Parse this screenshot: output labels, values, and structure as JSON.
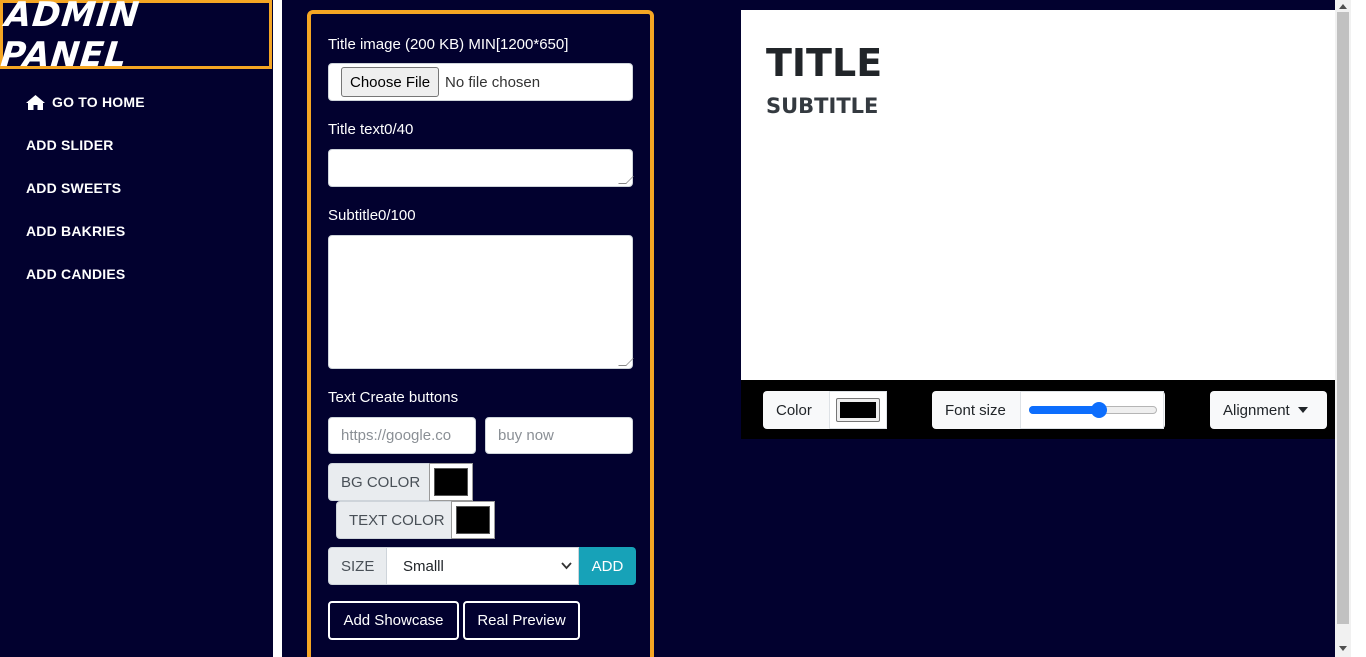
{
  "sidebar": {
    "brand": "ADMIN PANEL",
    "items": [
      {
        "label": "GO TO HOME",
        "icon": "home-icon"
      },
      {
        "label": "ADD SLIDER"
      },
      {
        "label": "ADD SWEETS"
      },
      {
        "label": "ADD BAKRIES"
      },
      {
        "label": "ADD CANDIES"
      }
    ]
  },
  "form": {
    "image_label": "Title image (200 KB) MIN[1200*650]",
    "file_button": "Choose File",
    "file_status": "No file chosen",
    "title_label": "Title text0/40",
    "subtitle_label": "Subtitle0/100",
    "buttons_label": "Text Create buttons",
    "url_placeholder": "https://google.co",
    "text_placeholder": "buy now",
    "bg_color_label": "BG COLOR",
    "text_color_label": "TEXT COLOR",
    "size_label": "SIZE",
    "size_value": "Smalll",
    "add_label": "ADD",
    "add_showcase": "Add Showcase",
    "real_preview": "Real Preview"
  },
  "preview": {
    "title": "TITLE",
    "subtitle": "SUBTITLE"
  },
  "toolbar": {
    "color_label": "Color",
    "font_size_label": "Font size",
    "font_size_level": 0.55,
    "alignment_label": "Alignment"
  },
  "colors": {
    "accent": "#f5a623",
    "background": "#02012f",
    "add_button": "#17a2b8",
    "slider": "#0d6efd",
    "bg_swatch": "#000000",
    "text_swatch": "#000000"
  }
}
